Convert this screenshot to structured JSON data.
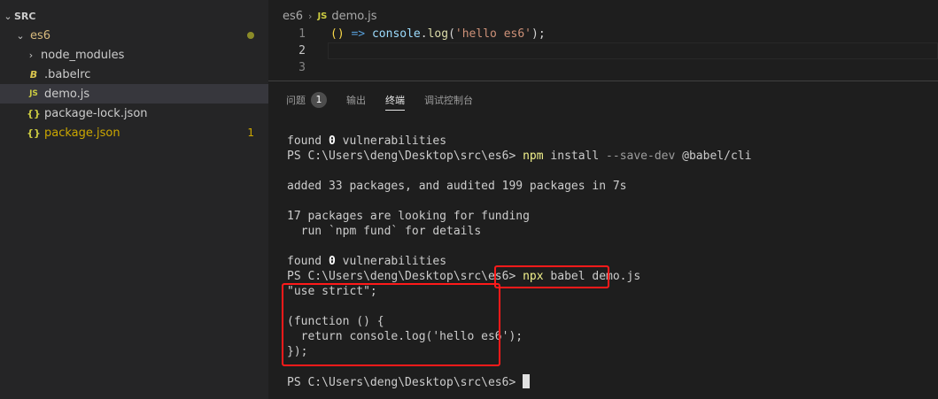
{
  "sidebar": {
    "section": "SRC",
    "folder": "es6",
    "items": [
      {
        "label": "node_modules",
        "icon": "chevron-right-icon",
        "icon_color": "#c5c5c5"
      },
      {
        "label": ".babelrc",
        "icon": "B",
        "icon_color": "#d9c44e"
      },
      {
        "label": "demo.js",
        "icon": "JS",
        "icon_color": "#cbcb41"
      },
      {
        "label": "package-lock.json",
        "icon": "{}",
        "icon_color": "#cbcb41"
      },
      {
        "label": "package.json",
        "icon": "{}",
        "icon_color": "#cbcb41",
        "badge": "1"
      }
    ]
  },
  "editor": {
    "breadcrumb": {
      "folder": "es6",
      "file_icon": "JS",
      "file": "demo.js"
    },
    "lines": [
      "1",
      "2",
      "3"
    ],
    "code": {
      "paren": "()",
      "arrow": "=>",
      "obj": "console",
      "dot": ".",
      "fn": "log",
      "open": "(",
      "str": "'hello es6'",
      "close": ");"
    }
  },
  "panel": {
    "tabs": [
      "问题",
      "输出",
      "终端",
      "调试控制台"
    ],
    "problems_count": "1",
    "active_tab": "终端"
  },
  "terminal": {
    "found1": "found ",
    "zero1": "0",
    "vuln1": " vulnerabilities",
    "prompt": "PS C:\\Users\\deng\\Desktop\\src\\es6> ",
    "cmd1_npm": "npm",
    "cmd1_install": " install ",
    "cmd1_flag": "--save-dev",
    "cmd1_pkg": " @babel/cli",
    "added": "added 33 packages, and audited 199 packages in 7s",
    "funding1": "17 packages are looking for funding",
    "funding2": "  run `npm fund` for details",
    "found2": "found ",
    "zero2": "0",
    "vuln2": " vulnerabilities",
    "cmd2_npx": "npx",
    "cmd2_rest": " babel demo.js",
    "out1": "\"use strict\";",
    "out2": "(function () {",
    "out3": "  return console.log('hello es6');",
    "out4": "});",
    "final_prompt": "PS C:\\Users\\deng\\Desktop\\src\\es6> "
  }
}
